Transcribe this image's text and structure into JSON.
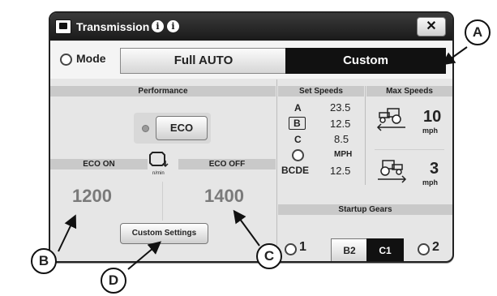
{
  "window": {
    "title": "Transmission",
    "info_icons": [
      "info-icon",
      "info-icon"
    ],
    "close_label": "✕"
  },
  "mode": {
    "label": "Mode",
    "options": [
      "Full AUTO",
      "Custom"
    ],
    "selected": "Custom"
  },
  "performance": {
    "header": "Performance",
    "eco_button": "ECO",
    "eco_on_label": "ECO ON",
    "eco_off_label": "ECO OFF",
    "rpm_unit": "n/min",
    "eco_on_value": "1200",
    "eco_off_value": "1400",
    "custom_settings_button": "Custom Settings"
  },
  "set_speeds": {
    "header": "Set Speeds",
    "rows": [
      {
        "label": "A",
        "value": "23.5"
      },
      {
        "label": "B",
        "value": "12.5"
      },
      {
        "label": "C",
        "value": "8.5"
      },
      {
        "label": "",
        "value": "MPH"
      },
      {
        "label": "BCDE",
        "value": "12.5"
      }
    ]
  },
  "max_speeds": {
    "header": "Max Speeds",
    "forward": {
      "value": "10",
      "unit": "mph"
    },
    "reverse": {
      "value": "3",
      "unit": "mph"
    }
  },
  "startup_gears": {
    "header": "Startup Gears",
    "left_option": "1",
    "right_option": "2",
    "gears": [
      "B2",
      "C1"
    ],
    "selected": "C1"
  },
  "callouts": [
    "A",
    "B",
    "C",
    "D"
  ]
}
